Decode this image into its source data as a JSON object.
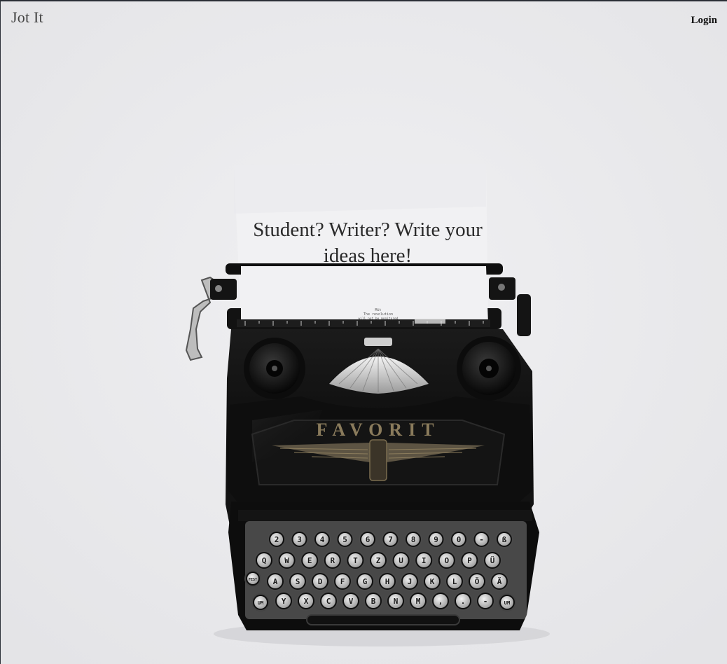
{
  "header": {
    "brand": "Jot It",
    "login_label": "Login"
  },
  "hero": {
    "headline_line1": "Student? Writer? Write your",
    "headline_line2": "ideas here!"
  },
  "typewriter": {
    "brand_plate": "FAVORIT",
    "paper_note_1": "Mit",
    "paper_note_2": "The revolution",
    "paper_note_3": "will not be monitored",
    "keys_row_numbers": [
      "2",
      "3",
      "4",
      "5",
      "6",
      "7",
      "8",
      "9",
      "0",
      "-",
      "ß"
    ],
    "keys_row_1": [
      "Q",
      "W",
      "E",
      "R",
      "T",
      "Z",
      "U",
      "I",
      "O",
      "P",
      "Ü"
    ],
    "keys_row_2": [
      "A",
      "S",
      "D",
      "F",
      "G",
      "H",
      "J",
      "K",
      "L",
      "Ö",
      "Ä"
    ],
    "keys_row_3": [
      "Y",
      "X",
      "C",
      "V",
      "B",
      "N",
      "M",
      ",",
      ".",
      "-"
    ],
    "key_fest": "FEST",
    "key_um_left": "UM",
    "key_um_right": "UM"
  },
  "colors": {
    "background": "#ebebed",
    "paper": "#f1f1f3",
    "typewriter_body": "#111111",
    "key_face": "#d9d9d9",
    "text": "#2a2a2a"
  }
}
